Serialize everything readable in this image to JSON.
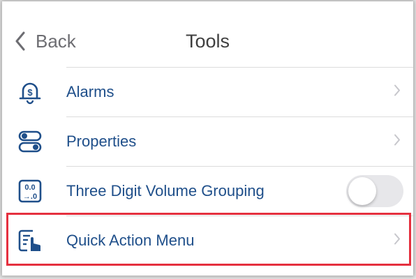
{
  "nav": {
    "back_label": "Back",
    "title": "Tools"
  },
  "items": [
    {
      "label": "Alarms",
      "icon": "alarm-dollar-icon",
      "control": "chevron"
    },
    {
      "label": "Properties",
      "icon": "toggles-icon",
      "control": "chevron"
    },
    {
      "label": "Three Digit Volume Grouping",
      "icon": "digit-grouping-icon",
      "control": "toggle",
      "toggle_on": false
    },
    {
      "label": "Quick Action Menu",
      "icon": "tap-menu-icon",
      "control": "chevron",
      "highlighted": true
    }
  ],
  "colors": {
    "item_text": "#1f4f8a",
    "icon": "#1f4f8a",
    "highlight_border": "#e5303f",
    "chevron": "#c7c7cc"
  }
}
